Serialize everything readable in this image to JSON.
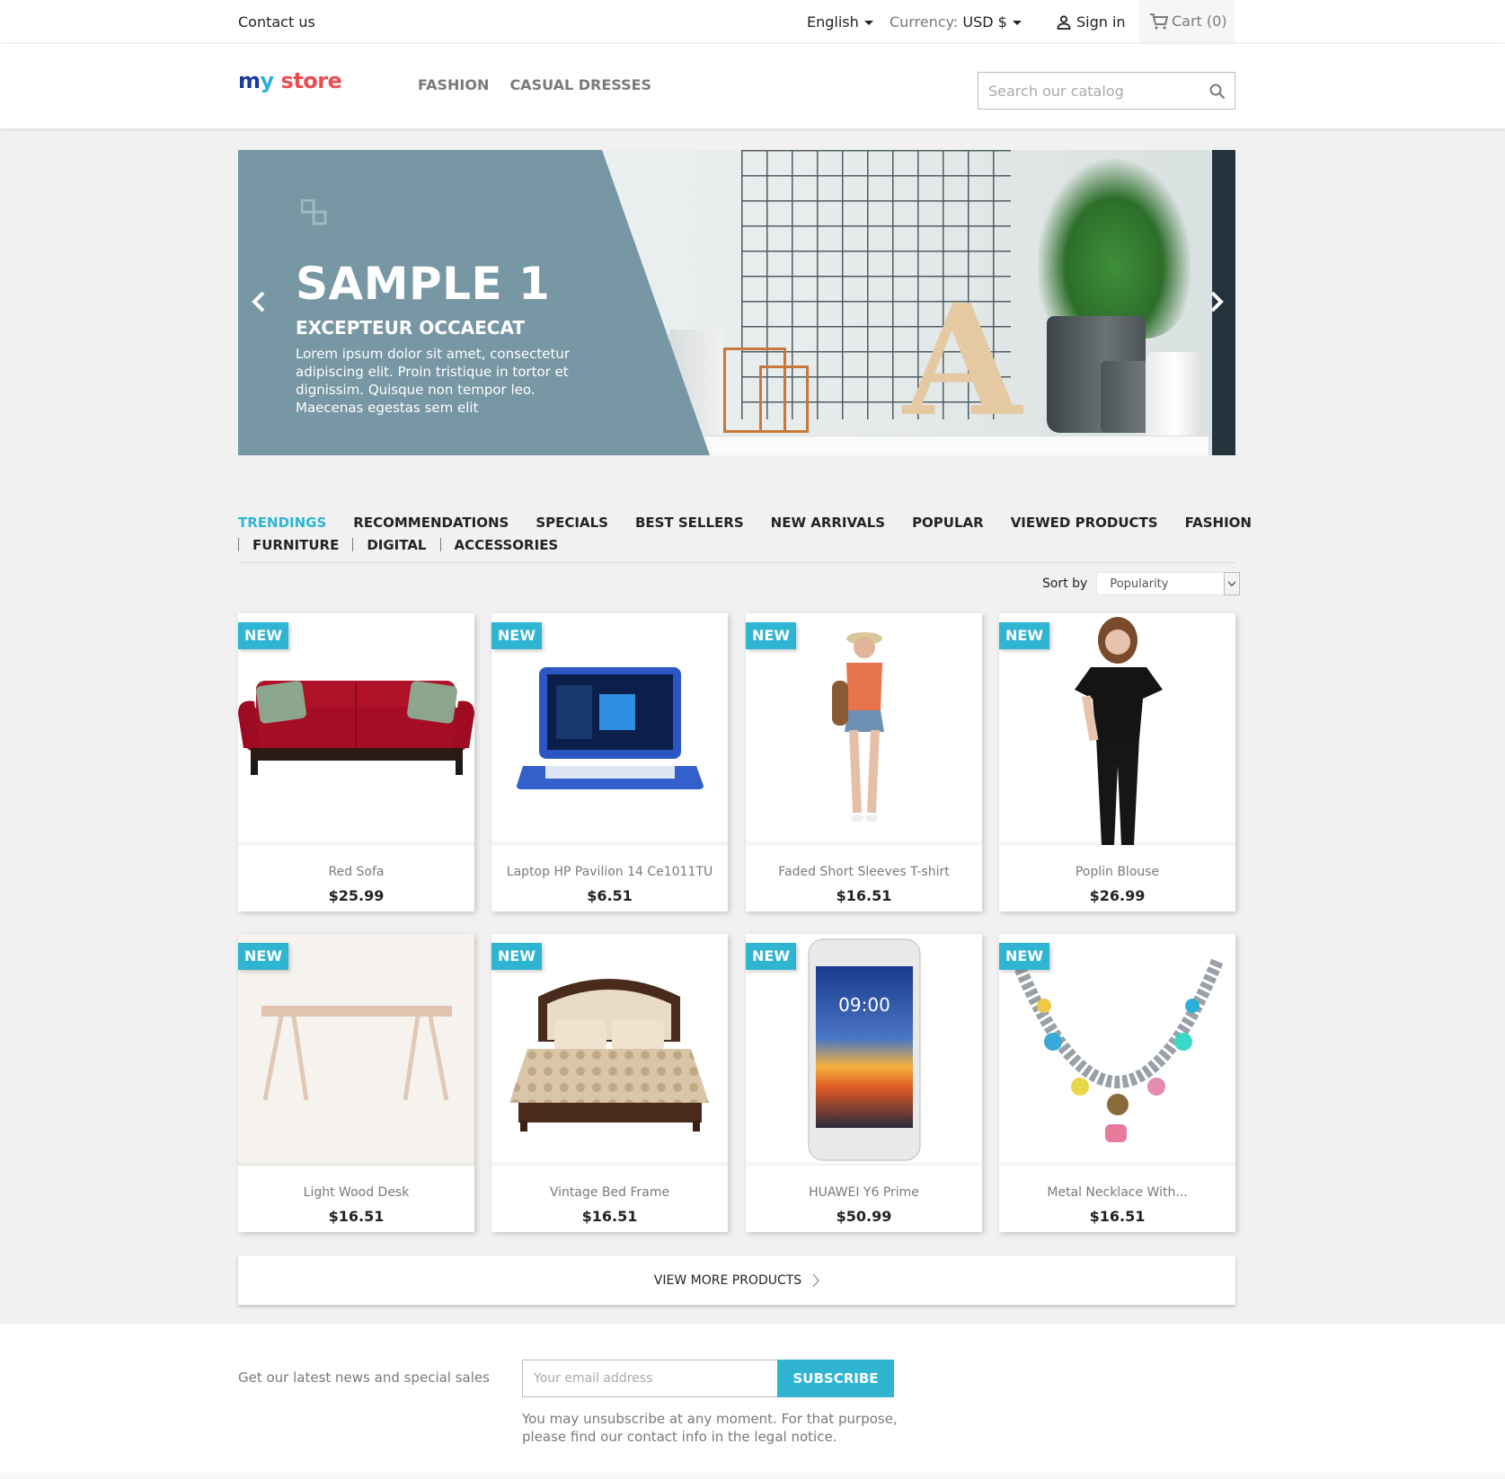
{
  "topbar": {
    "contact": "Contact us",
    "language": "English",
    "currency_label": "Currency:",
    "currency_value": "USD $",
    "signin": "Sign in",
    "cart": "Cart (0)"
  },
  "header": {
    "logo": {
      "part1": "m",
      "part2": "y",
      "part3": " store"
    },
    "menu": [
      "FASHION",
      "CASUAL DRESSES"
    ],
    "search_placeholder": "Search our catalog"
  },
  "banner": {
    "title": "SAMPLE 1",
    "subtitle": "EXCEPTEUR OCCAECAT",
    "text": "Lorem ipsum dolor sit amet, consectetur adipiscing elit. Proin tristique in tortor et dignissim. Quisque non tempor leo. Maecenas egestas sem elit"
  },
  "tabs": {
    "row1": [
      "TRENDINGS",
      "RECOMMENDATIONS",
      "SPECIALS",
      "BEST SELLERS",
      "NEW ARRIVALS",
      "POPULAR",
      "VIEWED PRODUCTS",
      "FASHION"
    ],
    "row2": [
      "FURNITURE",
      "DIGITAL",
      "ACCESSORIES"
    ],
    "active": "TRENDINGS"
  },
  "sort": {
    "label": "Sort by",
    "value": "Popularity"
  },
  "products": [
    {
      "badge": "NEW",
      "name": "Red Sofa",
      "price": "$25.99",
      "image": "sofa"
    },
    {
      "badge": "NEW",
      "name": "Laptop HP Pavilion 14 Ce1011TU",
      "price": "$6.51",
      "image": "laptop"
    },
    {
      "badge": "NEW",
      "name": "Faded Short Sleeves T-shirt",
      "price": "$16.51",
      "image": "woman-shorts"
    },
    {
      "badge": "NEW",
      "name": "Poplin Blouse",
      "price": "$26.99",
      "image": "woman-black"
    },
    {
      "badge": "NEW",
      "name": "Light Wood Desk",
      "price": "$16.51",
      "image": "desk"
    },
    {
      "badge": "NEW",
      "name": "Vintage Bed Frame",
      "price": "$16.51",
      "image": "bed"
    },
    {
      "badge": "NEW",
      "name": "HUAWEI Y6 Prime",
      "price": "$50.99",
      "image": "phone"
    },
    {
      "badge": "NEW",
      "name": "Metal Necklace With...",
      "price": "$16.51",
      "image": "necklace"
    }
  ],
  "phone_screen_time": "09:00",
  "view_more": "VIEW MORE PRODUCTS",
  "newsletter": {
    "lead": "Get our latest news and special sales",
    "email_placeholder": "Your email address",
    "button": "SUBSCRIBE",
    "note": "You may unsubscribe at any moment. For that purpose, please find our contact info in the legal notice."
  },
  "colors": {
    "accent": "#2fb5d2",
    "banner_panel": "#7797a4",
    "text": "#232323",
    "muted": "#7a7a7a"
  }
}
